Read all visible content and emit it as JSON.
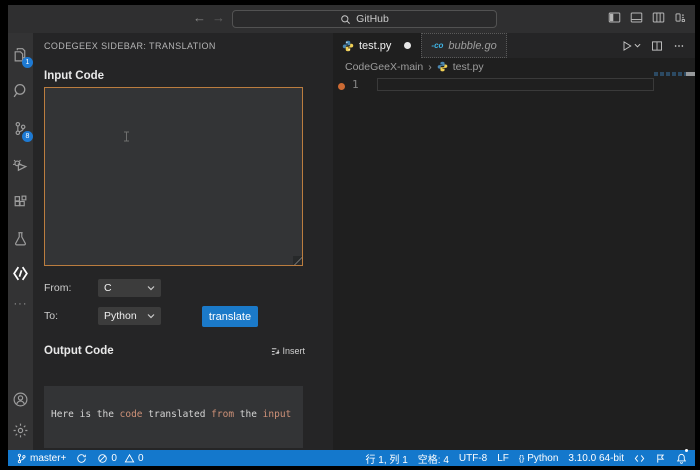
{
  "title_bar": {
    "back_glyph": "←",
    "forward_glyph": "→",
    "command_center_label": "GitHub"
  },
  "activity_bar": {
    "explorer_badge": "1",
    "scm_badge": "8",
    "more_glyph": "···"
  },
  "sidebar": {
    "header": "CODEGEEX SIDEBAR: TRANSLATION",
    "input_section": {
      "label": "Input Code",
      "textarea_value": ""
    },
    "from": {
      "label": "From:",
      "value": "C"
    },
    "to": {
      "label": "To:",
      "value": "Python"
    },
    "translate_button": "translate",
    "output_section": {
      "label": "Output Code",
      "insert_button": "Insert",
      "code_segments": [
        {
          "text": "Here is the ",
          "highlight": false
        },
        {
          "text": "code",
          "highlight": true
        },
        {
          "text": " translated ",
          "highlight": false
        },
        {
          "text": "from",
          "highlight": true
        },
        {
          "text": " the ",
          "highlight": false
        },
        {
          "text": "input",
          "highlight": true
        }
      ]
    }
  },
  "editor": {
    "tabs": [
      {
        "label": "test.py",
        "modified": true
      },
      {
        "label": "bubble.go",
        "preview": true
      }
    ],
    "go_icon_text": "-co",
    "breadcrumb": {
      "folder": "CodeGeeX-main",
      "separator": "›",
      "file": "test.py"
    },
    "gutter": {
      "line_number": "1"
    }
  },
  "status_bar": {
    "branch": "master+",
    "errors": "0",
    "warnings": "0",
    "cursor_position": "行 1, 列 1",
    "indentation": "空格: 4",
    "encoding": "UTF-8",
    "eol": "LF",
    "language_braces": "{}",
    "language": "Python",
    "interpreter": "3.10.0 64-bit"
  },
  "colors": {
    "status_blue": "#1478cc",
    "button_blue": "#1b7ac9",
    "badge_blue": "#1e7ad3",
    "focus_border_orange": "#bb7d3f",
    "syntax_orange": "#ce9178",
    "breakpoint_orange": "#cc6a33",
    "go_cyan": "#3fb6e8"
  }
}
